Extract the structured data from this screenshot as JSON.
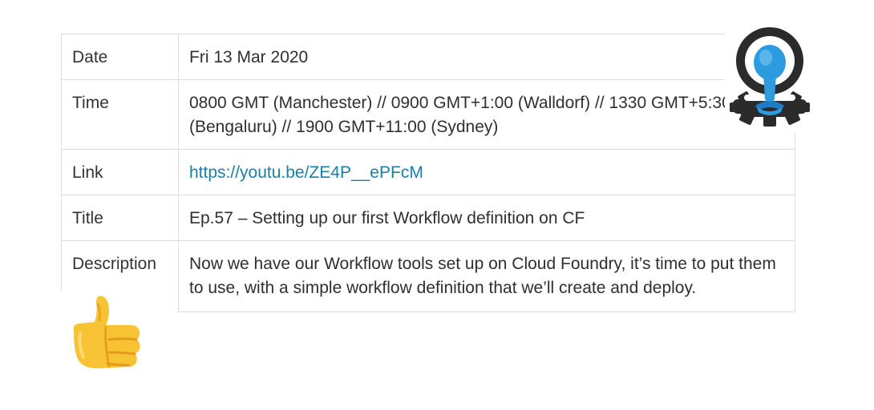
{
  "table": {
    "rows": [
      {
        "label": "Date",
        "value": "Fri 13 Mar 2020"
      },
      {
        "label": "Time",
        "value": "0800 GMT (Manchester) // 0900 GMT+1:00 (Walldorf) // 1330 GMT+5:30 (Bengaluru) // 1900 GMT+11:00 (Sydney)"
      },
      {
        "label": "Link",
        "value": "https://youtu.be/ZE4P__ePFcM"
      },
      {
        "label": "Title",
        "value": "Ep.57 – Setting up our first Workflow definition on CF"
      },
      {
        "label": "Description",
        "value": "Now we have our Workflow tools set up on Cloud Foundry, it’s time to put them to use, with a simple workflow definition that we’ll create and deploy."
      }
    ]
  },
  "icons": {
    "logo": "cloud-foundry-logo",
    "emoji": "thumbs-up-emoji"
  },
  "colors": {
    "link": "#1a7fa8",
    "logo_blue": "#2d9be0",
    "logo_dark": "#2b2b2b",
    "emoji_yellow": "#f7c234"
  }
}
